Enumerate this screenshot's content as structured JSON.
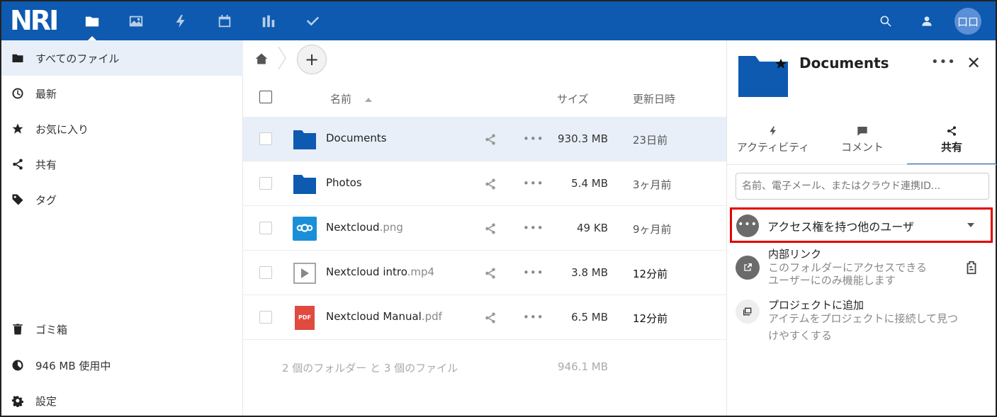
{
  "header": {
    "logo": "NRI",
    "apps": [
      {
        "name": "files",
        "icon": "folder-icon"
      },
      {
        "name": "photos",
        "icon": "image-icon"
      },
      {
        "name": "activity",
        "icon": "lightning-icon"
      },
      {
        "name": "calendar",
        "icon": "calendar-icon"
      },
      {
        "name": "dashboard",
        "icon": "bar-chart-icon"
      },
      {
        "name": "tasks",
        "icon": "checkmark-icon"
      }
    ],
    "avatar_initials": "口口"
  },
  "sidebar": {
    "items": [
      {
        "label": "すべてのファイル",
        "icon": "folder-icon"
      },
      {
        "label": "最新",
        "icon": "clock-icon"
      },
      {
        "label": "お気に入り",
        "icon": "star-icon"
      },
      {
        "label": "共有",
        "icon": "share-icon"
      },
      {
        "label": "タグ",
        "icon": "tag-icon"
      }
    ],
    "bottom": [
      {
        "label": "ゴミ箱",
        "icon": "trash-icon"
      },
      {
        "label": "946 MB 使用中",
        "icon": "pie-icon"
      },
      {
        "label": "設定",
        "icon": "gear-icon"
      }
    ]
  },
  "filelist": {
    "add_label": "+",
    "columns": {
      "name": "名前",
      "size": "サイズ",
      "modified": "更新日時"
    },
    "rows": [
      {
        "base": "Documents",
        "ext": "",
        "size": "930.3 MB",
        "modified": "23日前",
        "type": "folder"
      },
      {
        "base": "Photos",
        "ext": "",
        "size": "5.4 MB",
        "modified": "3ヶ月前",
        "type": "folder"
      },
      {
        "base": "Nextcloud",
        "ext": ".png",
        "size": "49 KB",
        "modified": "9ヶ月前",
        "type": "image"
      },
      {
        "base": "Nextcloud intro",
        "ext": ".mp4",
        "size": "3.8 MB",
        "modified": "12分前",
        "type": "video"
      },
      {
        "base": "Nextcloud Manual",
        "ext": ".pdf",
        "size": "6.5 MB",
        "modified": "12分前",
        "type": "pdf"
      }
    ],
    "more_label": "•••",
    "pdf_badge": "PDF",
    "summary_text": "2 個のフォルダー と 3 個のファイル",
    "summary_size": "946.1 MB"
  },
  "details": {
    "title": "Documents",
    "more_label": "•••",
    "close_label": "✕",
    "tabs": [
      {
        "label": "アクティビティ",
        "icon": "lightning-icon"
      },
      {
        "label": "コメント",
        "icon": "comment-icon"
      },
      {
        "label": "共有",
        "icon": "share-icon"
      }
    ],
    "share_placeholder": "名前、電子メール、またはクラウド連携ID...",
    "others_label": "アクセス権を持つ他のユーザ",
    "others_dots": "•••",
    "internal_link_title": "内部リンク",
    "internal_link_desc_1": "このフォルダーにアクセスできる",
    "internal_link_desc_2": "ユーザーにのみ機能します",
    "project_title": "プロジェクトに追加",
    "project_desc_1": "アイテムをプロジェクトに接続して見つ",
    "project_desc_2": "けやすくする"
  },
  "colors": {
    "header_bg": "#0d5ab0",
    "folder": "#0d5ab0",
    "highlight_border": "#e30000",
    "selected_row": "#e8eff8"
  }
}
